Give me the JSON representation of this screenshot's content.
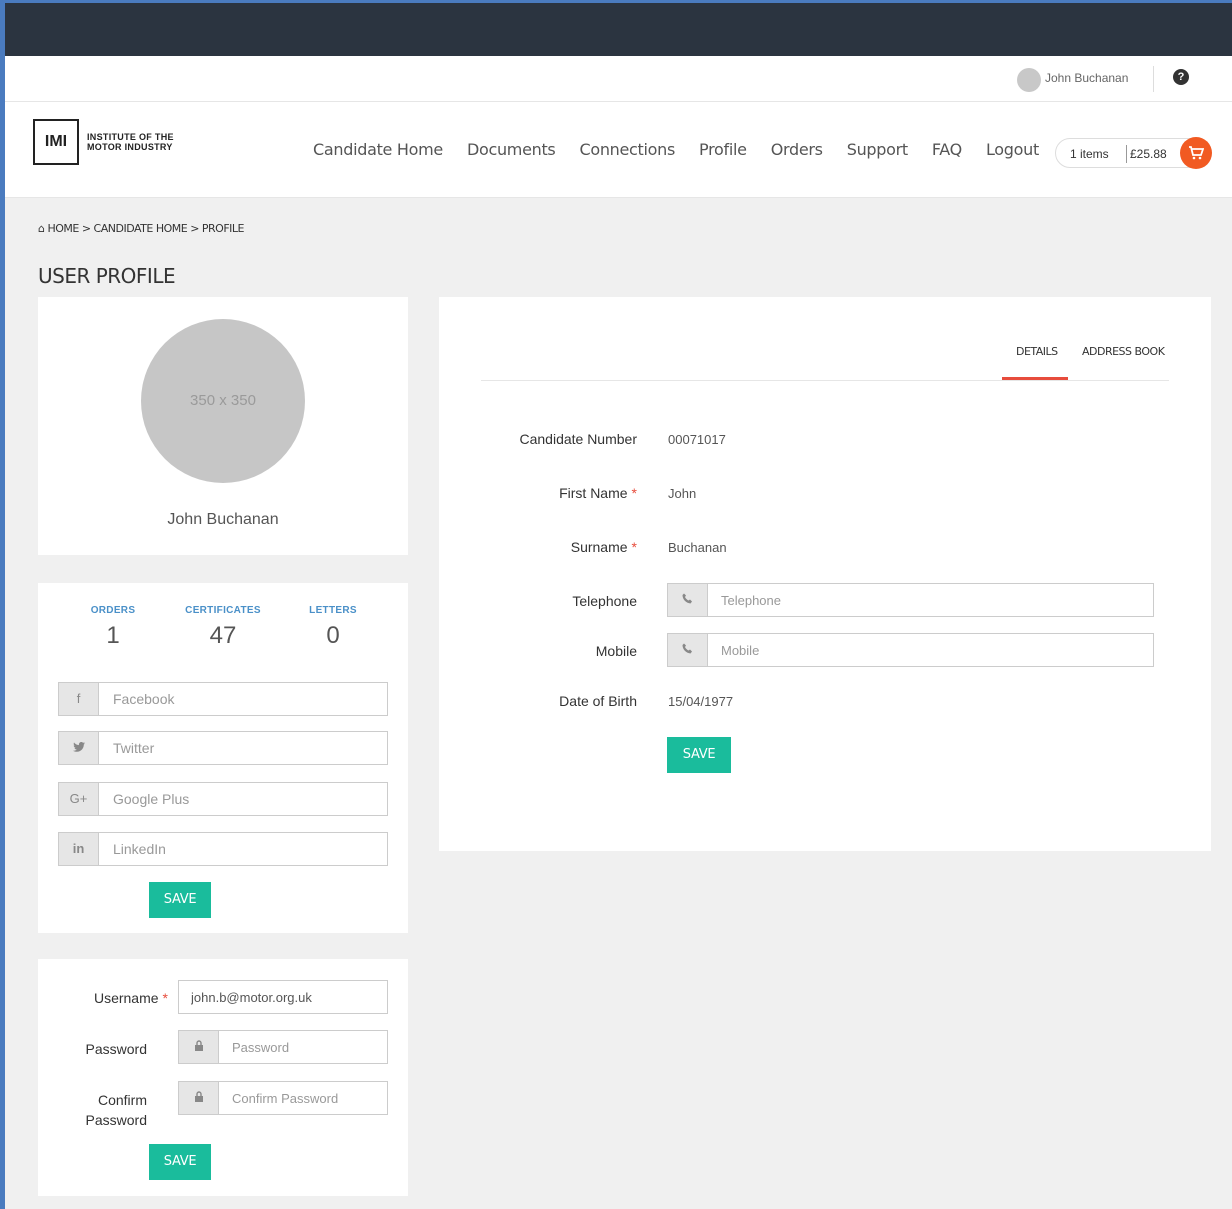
{
  "header": {
    "user_name": "John Buchanan",
    "help_icon": "question-circle-icon"
  },
  "brand": {
    "abbr": "IMI",
    "line1": "INSTITUTE OF THE",
    "line2": "MOTOR INDUSTRY"
  },
  "nav": {
    "items": [
      "Candidate Home",
      "Documents",
      "Connections",
      "Profile",
      "Orders",
      "Support",
      "FAQ",
      "Logout"
    ]
  },
  "cart": {
    "items": "1 items",
    "total": "£25.88",
    "icon": "shopping-cart-icon"
  },
  "breadcrumb": {
    "text": "⌂ HOME  >  CANDIDATE HOME  >  PROFILE"
  },
  "page": {
    "title": "USER PROFILE"
  },
  "profile_card": {
    "avatar_placeholder": "350 x 350",
    "full_name": "John Buchanan"
  },
  "stats": {
    "orders_label": "ORDERS",
    "orders_value": "1",
    "certificates_label": "CERTIFICATES",
    "certificates_value": "47",
    "letters_label": "LETTERS",
    "letters_value": "0"
  },
  "social": {
    "facebook_placeholder": "Facebook",
    "twitter_placeholder": "Twitter",
    "googleplus_placeholder": "Google Plus",
    "linkedin_placeholder": "LinkedIn",
    "save_label": "SAVE"
  },
  "account": {
    "username_label": "Username",
    "username_value": "john.b@motor.org.uk",
    "password_label": "Password",
    "password_placeholder": "Password",
    "confirm_label": "Confirm Password",
    "confirm_placeholder": "Confirm Password",
    "save_label": "SAVE"
  },
  "details": {
    "tab_details": "DETAILS",
    "tab_address": "ADDRESS BOOK",
    "candidate_number_label": "Candidate Number",
    "candidate_number_value": "00071017",
    "first_name_label": "First Name",
    "first_name_value": "John",
    "surname_label": "Surname",
    "surname_value": "Buchanan",
    "telephone_label": "Telephone",
    "telephone_placeholder": "Telephone",
    "mobile_label": "Mobile",
    "mobile_placeholder": "Mobile",
    "dob_label": "Date of Birth",
    "dob_value": "15/04/1977",
    "save_label": "SAVE"
  }
}
